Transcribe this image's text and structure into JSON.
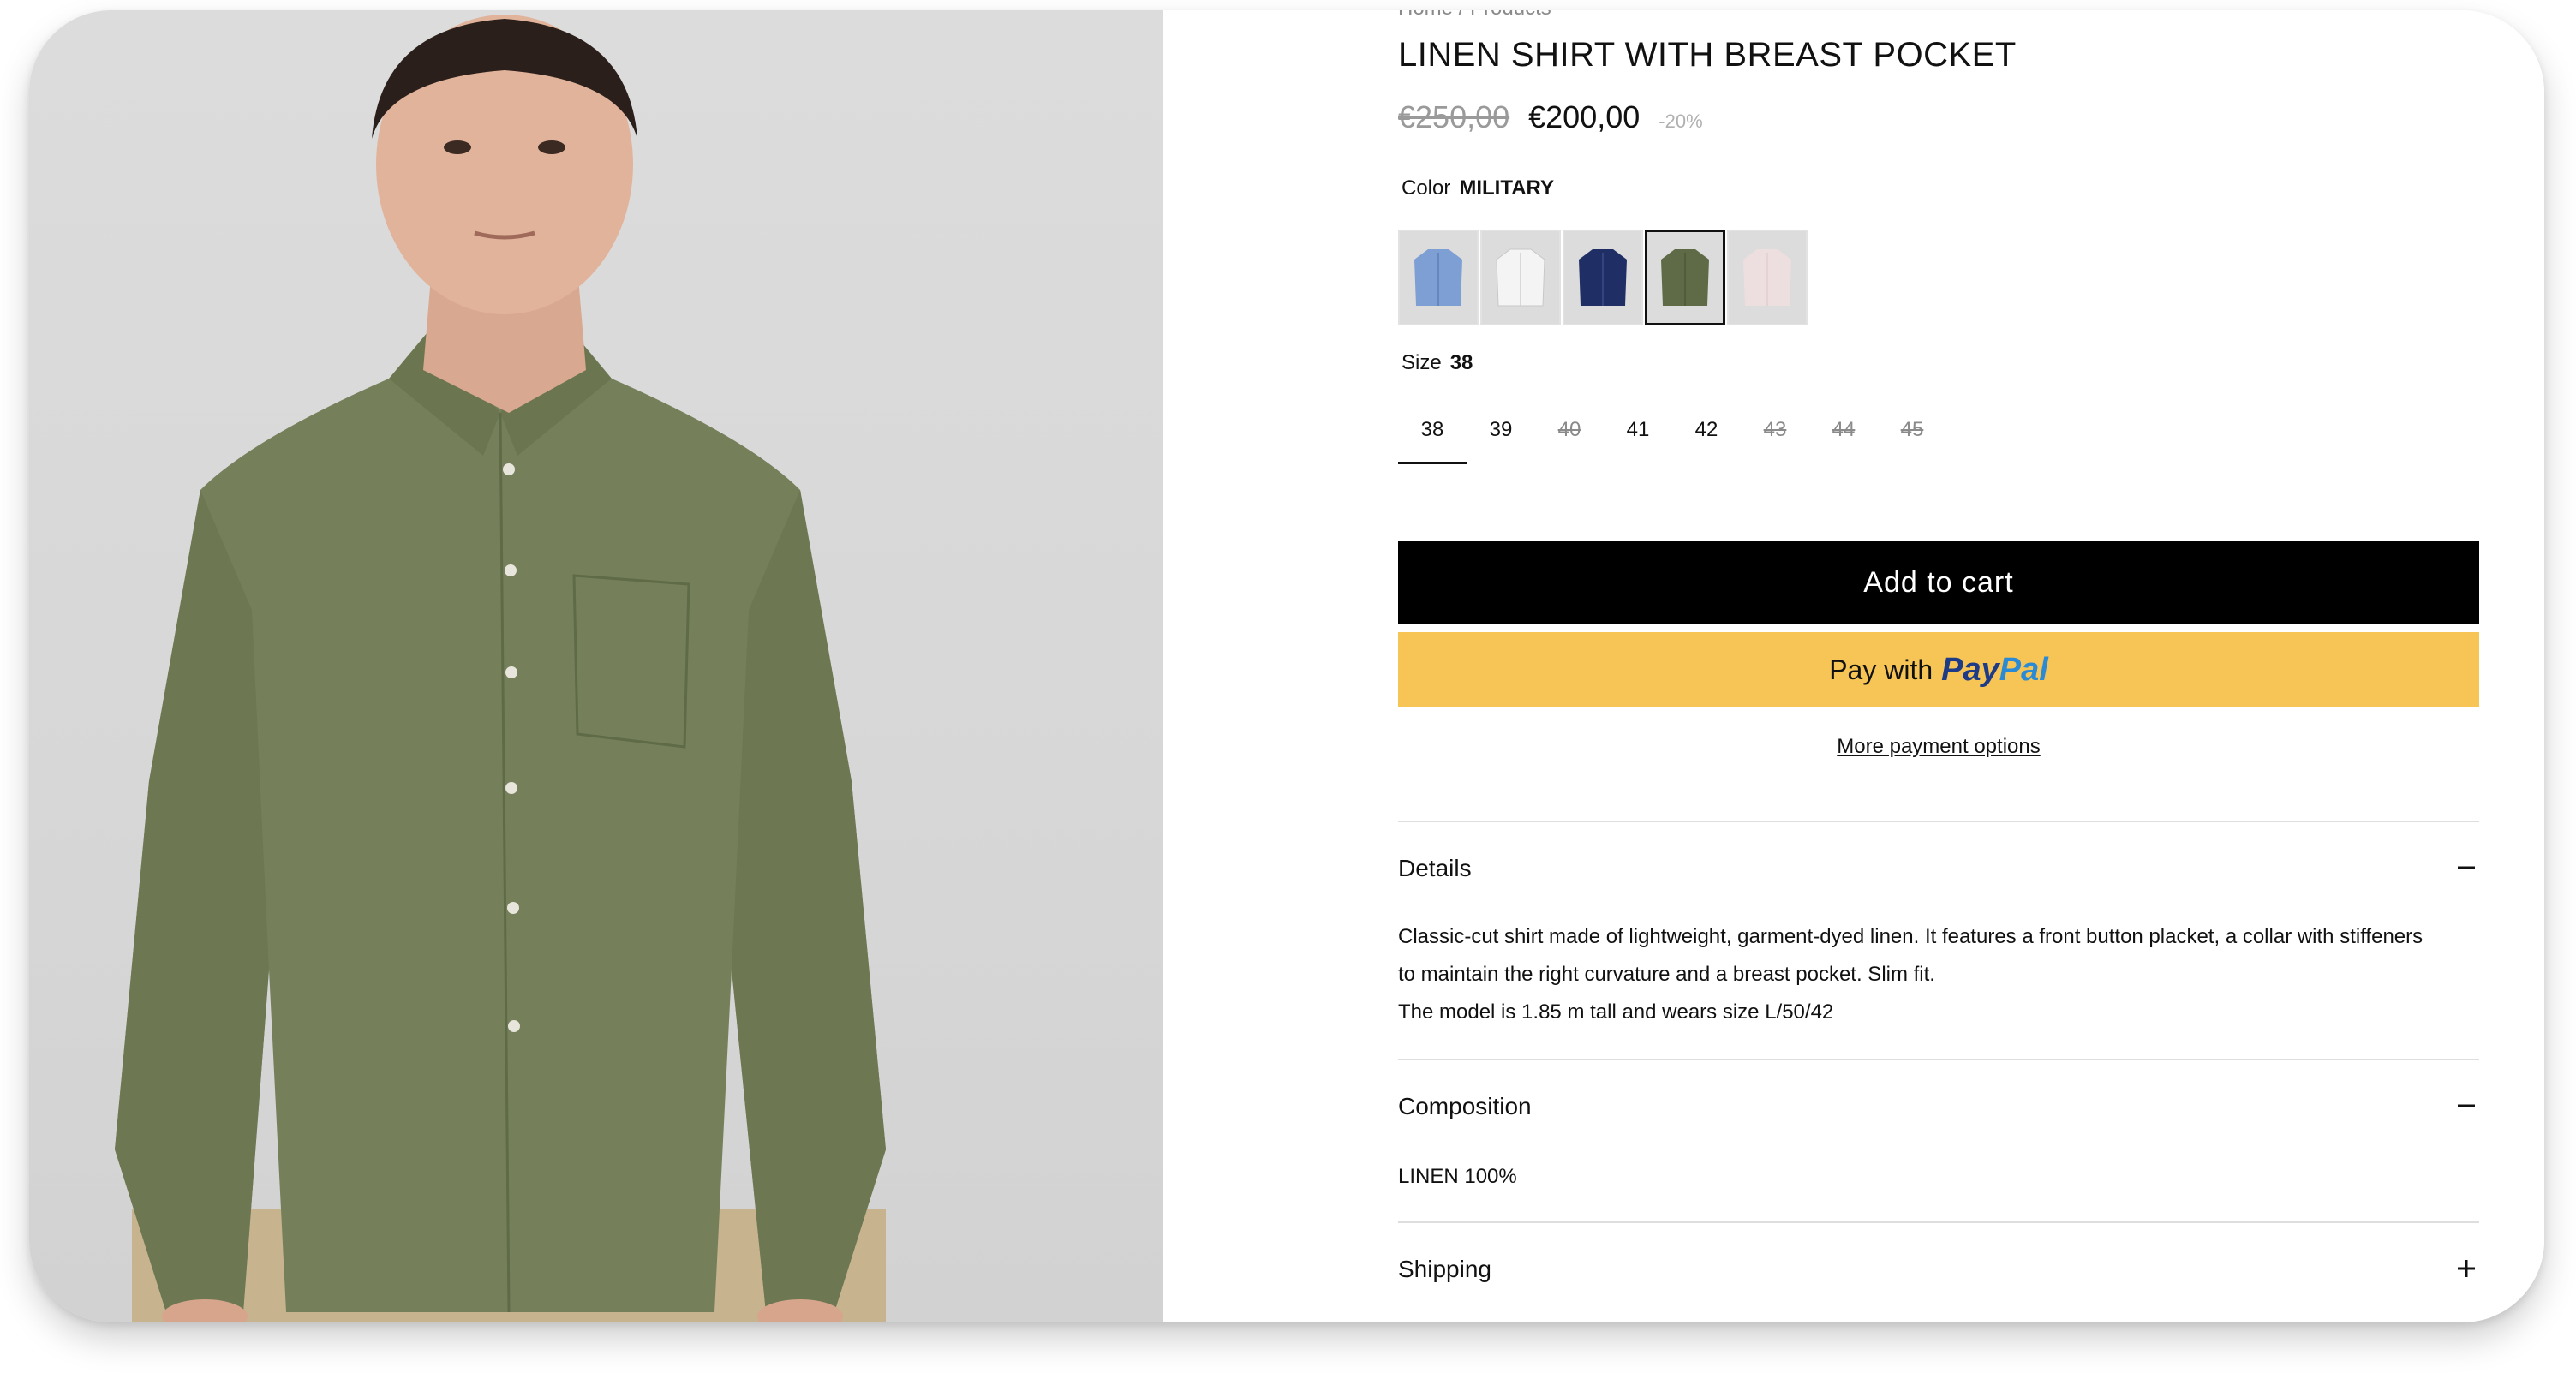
{
  "breadcrumb": "Home / Products",
  "product": {
    "title": "LINEN SHIRT WITH BREAST POCKET",
    "old_price": "€250,00",
    "price": "€200,00",
    "discount": "-20%"
  },
  "color": {
    "label": "Color",
    "selected": "MILITARY",
    "options": [
      {
        "name": "light-blue",
        "color": "#7d9fd4"
      },
      {
        "name": "white",
        "color": "#f2f2f2"
      },
      {
        "name": "navy",
        "color": "#1f2f66"
      },
      {
        "name": "military",
        "color": "#5f6b47",
        "selected": true
      },
      {
        "name": "pink",
        "color": "#f1dfe1",
        "faded": true
      }
    ]
  },
  "size": {
    "label": "Size",
    "selected": "38",
    "options": [
      {
        "label": "38",
        "available": true,
        "selected": true
      },
      {
        "label": "39",
        "available": true
      },
      {
        "label": "40",
        "available": false
      },
      {
        "label": "41",
        "available": true
      },
      {
        "label": "42",
        "available": true
      },
      {
        "label": "43",
        "available": false
      },
      {
        "label": "44",
        "available": false
      },
      {
        "label": "45",
        "available": false
      }
    ]
  },
  "buttons": {
    "add_to_cart": "Add to cart",
    "paypal_prefix": "Pay with",
    "paypal_brand_1": "Pay",
    "paypal_brand_2": "Pal",
    "more_payment": "More payment options"
  },
  "accordion": {
    "details": {
      "title": "Details",
      "line1": "Classic-cut shirt made of lightweight, garment-dyed linen. It features a front button placket, a collar with stiffeners",
      "line2": "to maintain the right curvature and a breast pocket. Slim fit.",
      "line3": "The model is 1.85 m tall and wears size L/50/42"
    },
    "composition": {
      "title": "Composition",
      "body": "LINEN 100%"
    },
    "shipping": {
      "title": "Shipping"
    }
  },
  "colors": {
    "accent_black": "#000000",
    "paypal_yellow": "#f6c555",
    "paypal_navy": "#1d3b86",
    "paypal_blue": "#2a8ad6"
  }
}
